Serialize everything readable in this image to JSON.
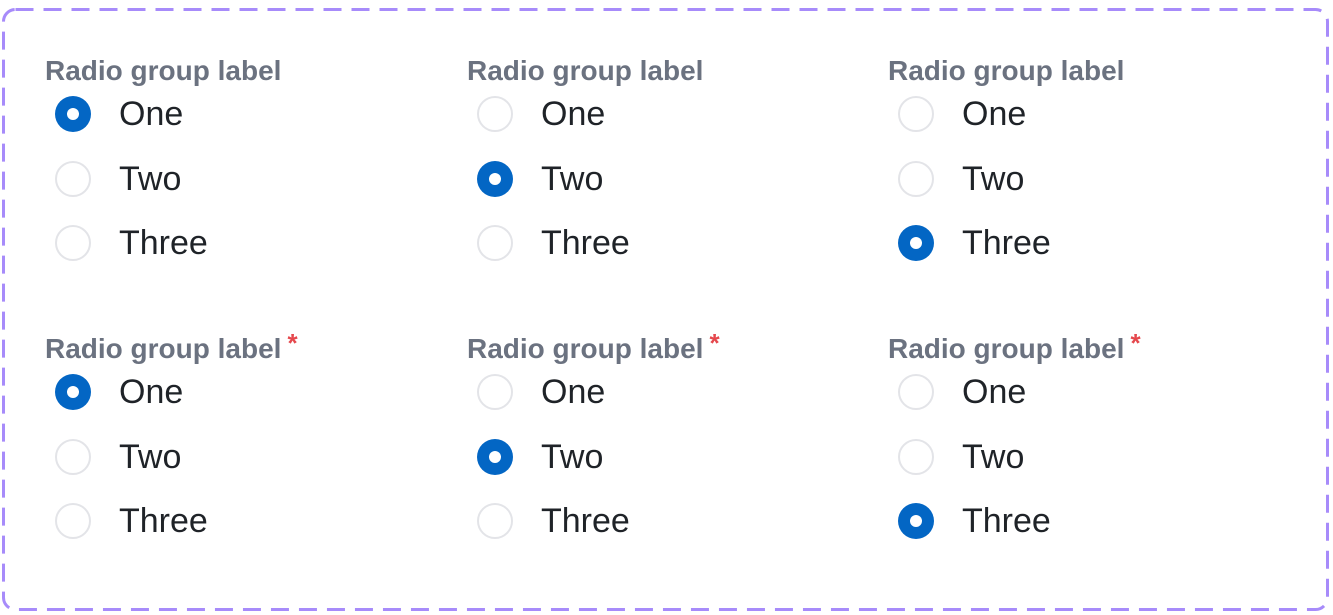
{
  "groups": [
    {
      "label": "Radio group label",
      "required": false,
      "options": [
        "One",
        "Two",
        "Three"
      ],
      "selected": 0
    },
    {
      "label": "Radio group label",
      "required": false,
      "options": [
        "One",
        "Two",
        "Three"
      ],
      "selected": 1
    },
    {
      "label": "Radio group label",
      "required": false,
      "options": [
        "One",
        "Two",
        "Three"
      ],
      "selected": 2
    },
    {
      "label": "Radio group label",
      "required": true,
      "options": [
        "One",
        "Two",
        "Three"
      ],
      "selected": 0
    },
    {
      "label": "Radio group label",
      "required": true,
      "options": [
        "One",
        "Two",
        "Three"
      ],
      "selected": 1
    },
    {
      "label": "Radio group label",
      "required": true,
      "options": [
        "One",
        "Two",
        "Three"
      ],
      "selected": 2
    }
  ],
  "required_marker": "*",
  "colors": {
    "accent": "#0366c4",
    "label": "#6b7280",
    "required": "#e5484d",
    "frame_dash": "#a78bfa",
    "text": "#1f2328"
  }
}
